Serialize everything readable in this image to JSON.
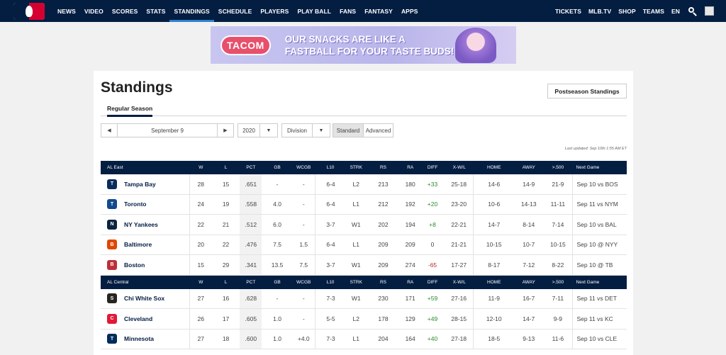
{
  "nav": {
    "items": [
      "NEWS",
      "VIDEO",
      "SCORES",
      "STATS",
      "STANDINGS",
      "SCHEDULE",
      "PLAYERS",
      "PLAY BALL",
      "FANS",
      "FANTASY",
      "APPS"
    ],
    "right": [
      "TICKETS",
      "MLB.TV",
      "SHOP",
      "TEAMS",
      "EN"
    ]
  },
  "ad": {
    "brand": "TACOM",
    "text": "OUR SNACKS ARE LIKE A FASTBALL FOR YOUR TASTE BUDS!"
  },
  "page": {
    "title": "Standings",
    "postseason_label": "Postseason Standings",
    "subtab": "Regular Season",
    "date": "September 9",
    "year": "2020",
    "view": "Division",
    "standard_label": "Standard",
    "advanced_label": "Advanced",
    "updated": "Last updated: Sep 10th 1:55 AM ET"
  },
  "columns": [
    "W",
    "L",
    "PCT",
    "GB",
    "WCGB",
    "L10",
    "STRK",
    "RS",
    "RA",
    "DIFF",
    "X-W/L",
    "HOME",
    "AWAY",
    ">.500",
    "Next Game"
  ],
  "divisions": [
    {
      "name": "AL East",
      "teams": [
        {
          "abbr": "TB",
          "name": "Tampa Bay",
          "w": "28",
          "l": "15",
          "pct": ".651",
          "gb": "-",
          "wcgb": "-",
          "l10": "6-4",
          "strk": "L2",
          "rs": "213",
          "ra": "180",
          "diff": "+33",
          "xwl": "25-18",
          "home": "14-6",
          "away": "14-9",
          "o500": "21-9",
          "next": "Sep 10 vs BOS",
          "color": "#092c5c"
        },
        {
          "abbr": "TOR",
          "name": "Toronto",
          "w": "24",
          "l": "19",
          "pct": ".558",
          "gb": "4.0",
          "wcgb": "-",
          "l10": "6-4",
          "strk": "L1",
          "rs": "212",
          "ra": "192",
          "diff": "+20",
          "xwl": "23-20",
          "home": "10-6",
          "away": "14-13",
          "o500": "11-11",
          "next": "Sep 11 vs NYM",
          "color": "#134a8e"
        },
        {
          "abbr": "NY",
          "name": "NY Yankees",
          "w": "22",
          "l": "21",
          "pct": ".512",
          "gb": "6.0",
          "wcgb": "-",
          "l10": "3-7",
          "strk": "W1",
          "rs": "202",
          "ra": "194",
          "diff": "+8",
          "xwl": "22-21",
          "home": "14-7",
          "away": "8-14",
          "o500": "7-14",
          "next": "Sep 10 vs BAL",
          "color": "#0c2340"
        },
        {
          "abbr": "BAL",
          "name": "Baltimore",
          "w": "20",
          "l": "22",
          "pct": ".476",
          "gb": "7.5",
          "wcgb": "1.5",
          "l10": "6-4",
          "strk": "L1",
          "rs": "209",
          "ra": "209",
          "diff": "0",
          "xwl": "21-21",
          "home": "10-15",
          "away": "10-7",
          "o500": "10-15",
          "next": "Sep 10 @ NYY",
          "color": "#df4601"
        },
        {
          "abbr": "B",
          "name": "Boston",
          "w": "15",
          "l": "29",
          "pct": ".341",
          "gb": "13.5",
          "wcgb": "7.5",
          "l10": "3-7",
          "strk": "W1",
          "rs": "209",
          "ra": "274",
          "diff": "-65",
          "xwl": "17-27",
          "home": "8-17",
          "away": "7-12",
          "o500": "8-22",
          "next": "Sep 10 @ TB",
          "color": "#bd3039"
        }
      ]
    },
    {
      "name": "AL Central",
      "teams": [
        {
          "abbr": "SX",
          "name": "Chi White Sox",
          "w": "27",
          "l": "16",
          "pct": ".628",
          "gb": "-",
          "wcgb": "-",
          "l10": "7-3",
          "strk": "W1",
          "rs": "230",
          "ra": "171",
          "diff": "+59",
          "xwl": "27-16",
          "home": "11-9",
          "away": "16-7",
          "o500": "7-11",
          "next": "Sep 11 vs DET",
          "color": "#27251f"
        },
        {
          "abbr": "C",
          "name": "Cleveland",
          "w": "26",
          "l": "17",
          "pct": ".605",
          "gb": "1.0",
          "wcgb": "-",
          "l10": "5-5",
          "strk": "L2",
          "rs": "178",
          "ra": "129",
          "diff": "+49",
          "xwl": "28-15",
          "home": "12-10",
          "away": "14-7",
          "o500": "9-9",
          "next": "Sep 11 vs KC",
          "color": "#e31937"
        },
        {
          "abbr": "TC",
          "name": "Minnesota",
          "w": "27",
          "l": "18",
          "pct": ".600",
          "gb": "1.0",
          "wcgb": "+4.0",
          "l10": "7-3",
          "strk": "L1",
          "rs": "204",
          "ra": "164",
          "diff": "+40",
          "xwl": "27-18",
          "home": "18-5",
          "away": "9-13",
          "o500": "11-6",
          "next": "Sep 10 vs CLE",
          "color": "#002b5c"
        }
      ]
    }
  ]
}
